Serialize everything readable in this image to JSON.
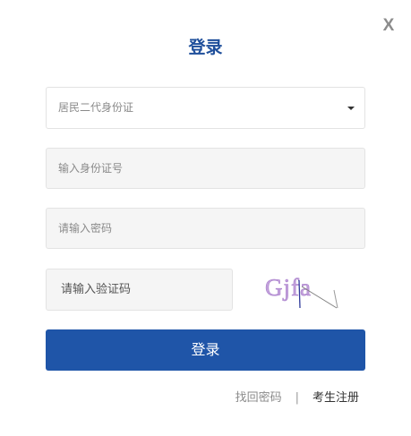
{
  "close_label": "X",
  "title": "登录",
  "id_type": {
    "selected": "居民二代身份证"
  },
  "id_number": {
    "placeholder": "输入身份证号"
  },
  "password": {
    "placeholder": "请输入密码"
  },
  "captcha": {
    "placeholder": "请输入验证码",
    "image_text": "Gjfa"
  },
  "login_button": "登录",
  "links": {
    "forgot_password": "找回密码",
    "separator": "|",
    "register": "考生注册"
  },
  "colors": {
    "brand_blue": "#1f55a8",
    "title_blue": "#1f4f9b"
  }
}
